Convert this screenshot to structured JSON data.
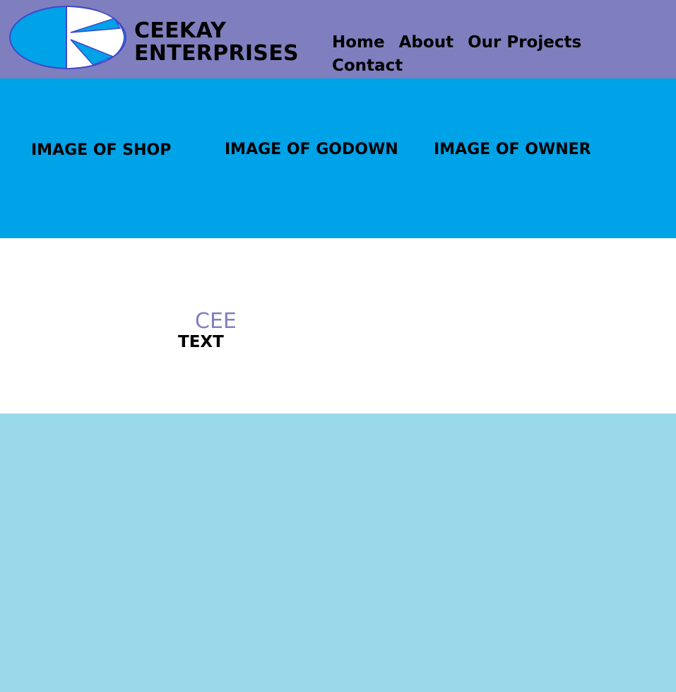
{
  "colors": {
    "header_bg": "#7f7fbf",
    "hero_bg": "#00a2e8",
    "content_bg": "#ffffff",
    "footer_bg": "#99d9ea",
    "logo_blue": "#00a2e8",
    "logo_outline": "#3f48cc",
    "cee_text": "#7f7fbf"
  },
  "header": {
    "logo_icon": "ceekay-k-logo-icon",
    "brand_line1": "CEEKAY",
    "brand_line2": "ENTERPRISES"
  },
  "nav": {
    "items": [
      {
        "label": "Home"
      },
      {
        "label": "About"
      },
      {
        "label": "Our Projects"
      },
      {
        "label": "Contact"
      }
    ]
  },
  "hero": {
    "placeholders": [
      {
        "label": "IMAGE OF SHOP"
      },
      {
        "label": "IMAGE OF GODOWN"
      },
      {
        "label": "IMAGE OF OWNER"
      }
    ]
  },
  "content": {
    "heading": "CEE",
    "text": "TEXT"
  }
}
